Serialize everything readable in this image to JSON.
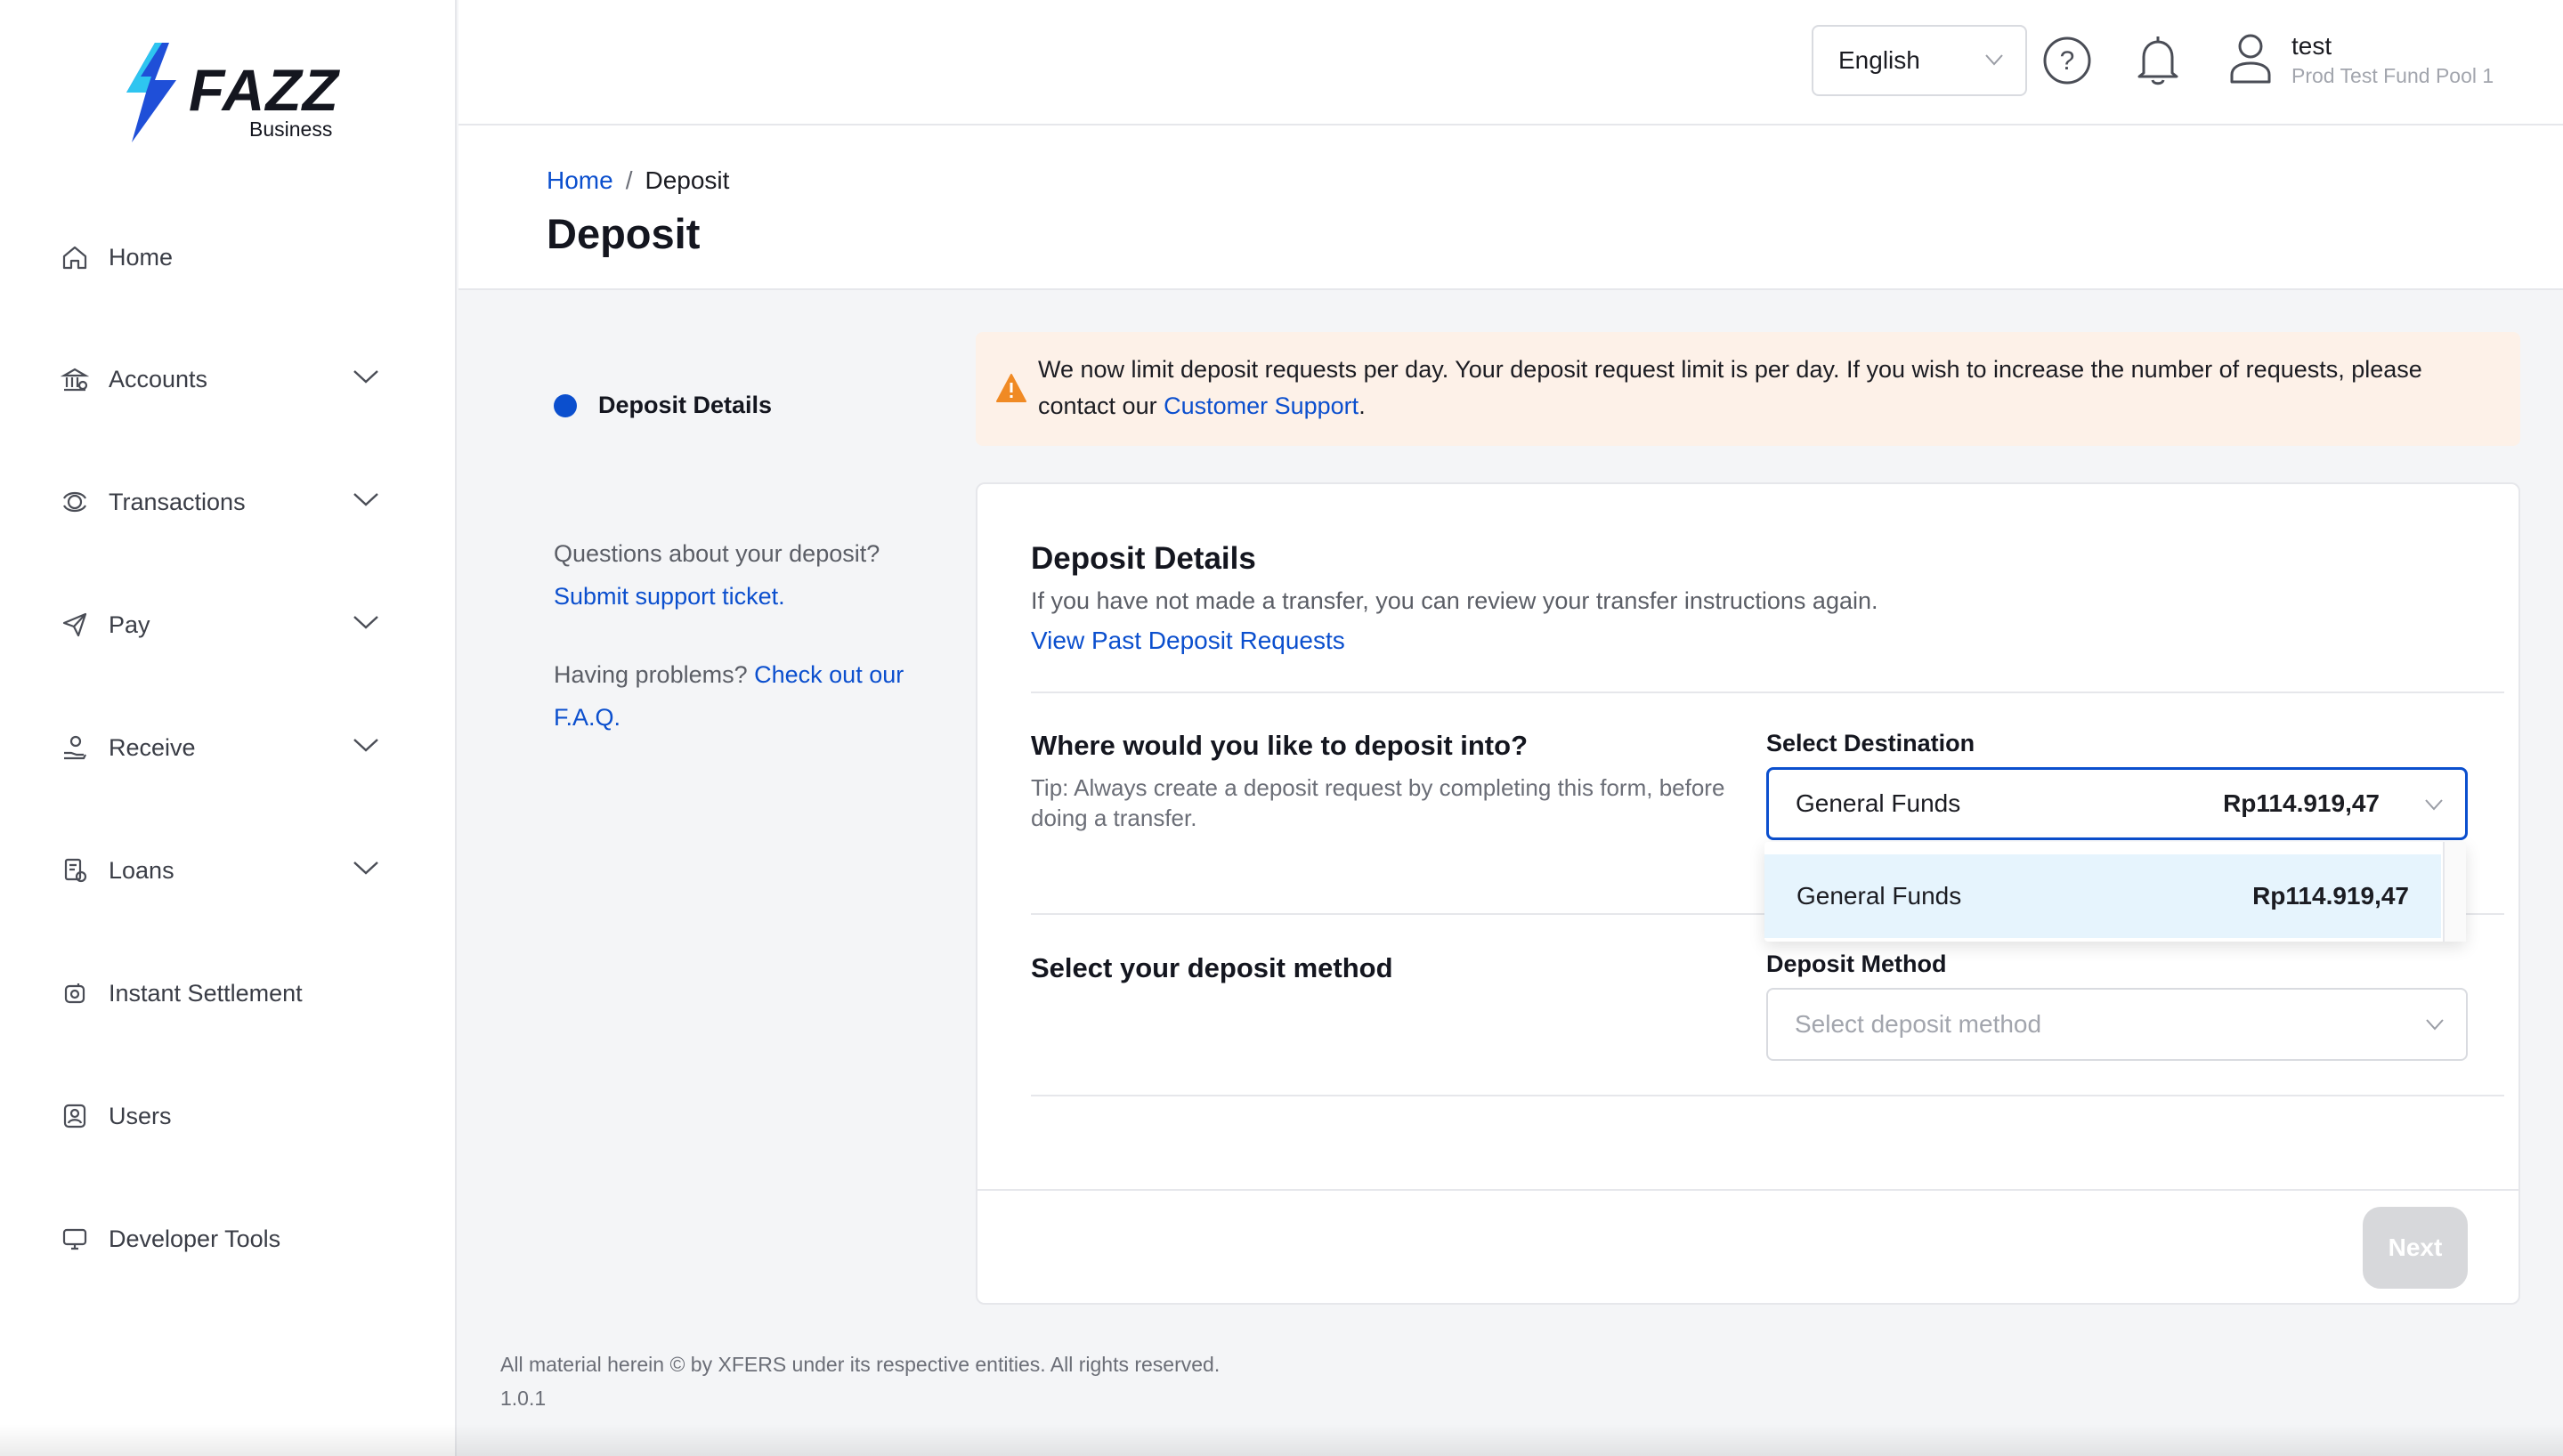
{
  "brand": {
    "name": "FAZZ",
    "sub": "Business",
    "accent": "#0b4fce",
    "logo_colors": [
      "#2ec5f0",
      "#1f4fd8"
    ]
  },
  "sidebar": {
    "items": [
      {
        "label": "Home",
        "icon": "home-icon",
        "expandable": false
      },
      {
        "label": "Accounts",
        "icon": "bank-icon",
        "expandable": true
      },
      {
        "label": "Transactions",
        "icon": "transactions-icon",
        "expandable": true
      },
      {
        "label": "Pay",
        "icon": "send-icon",
        "expandable": true
      },
      {
        "label": "Receive",
        "icon": "receive-icon",
        "expandable": true
      },
      {
        "label": "Loans",
        "icon": "loans-icon",
        "expandable": true
      },
      {
        "label": "Instant Settlement",
        "icon": "instant-settlement-icon",
        "expandable": false
      },
      {
        "label": "Users",
        "icon": "users-icon",
        "expandable": false
      },
      {
        "label": "Developer Tools",
        "icon": "developer-tools-icon",
        "expandable": false
      }
    ]
  },
  "topbar": {
    "language": "English",
    "user": {
      "name": "test",
      "org": "Prod Test Fund Pool 1"
    }
  },
  "breadcrumb": {
    "home": "Home",
    "separator": "/",
    "current": "Deposit"
  },
  "page": {
    "title": "Deposit"
  },
  "stepper": {
    "step_label": "Deposit Details"
  },
  "help": {
    "q1": "Questions about your deposit?",
    "q1_link": "Submit support ticket.",
    "q2": "Having problems?",
    "q2_link": "Check out our F.A.Q."
  },
  "alert": {
    "text": "We now limit deposit requests per day. Your deposit request limit is per day. If you wish to increase the number of requests, please contact our ",
    "link": "Customer Support",
    "end": "."
  },
  "card": {
    "title": "Deposit Details",
    "subtitle": "If you have not made a transfer, you can review your transfer instructions again.",
    "past_link": "View Past Deposit Requests",
    "destination": {
      "question": "Where would you like to deposit into?",
      "tip": "Tip: Always create a deposit request by completing this form, before doing a transfer.",
      "label": "Select Destination",
      "selected": "General Funds",
      "amount": "Rp114.919,47",
      "options": [
        {
          "label": "General Funds",
          "amount": "Rp114.919,47"
        }
      ]
    },
    "method": {
      "question": "Select your deposit method",
      "label": "Deposit Method",
      "placeholder": "Select deposit method"
    },
    "next_label": "Next"
  },
  "footer": {
    "copyright": "All material herein © by XFERS under its respective entities. All rights reserved.",
    "version": "1.0.1"
  }
}
